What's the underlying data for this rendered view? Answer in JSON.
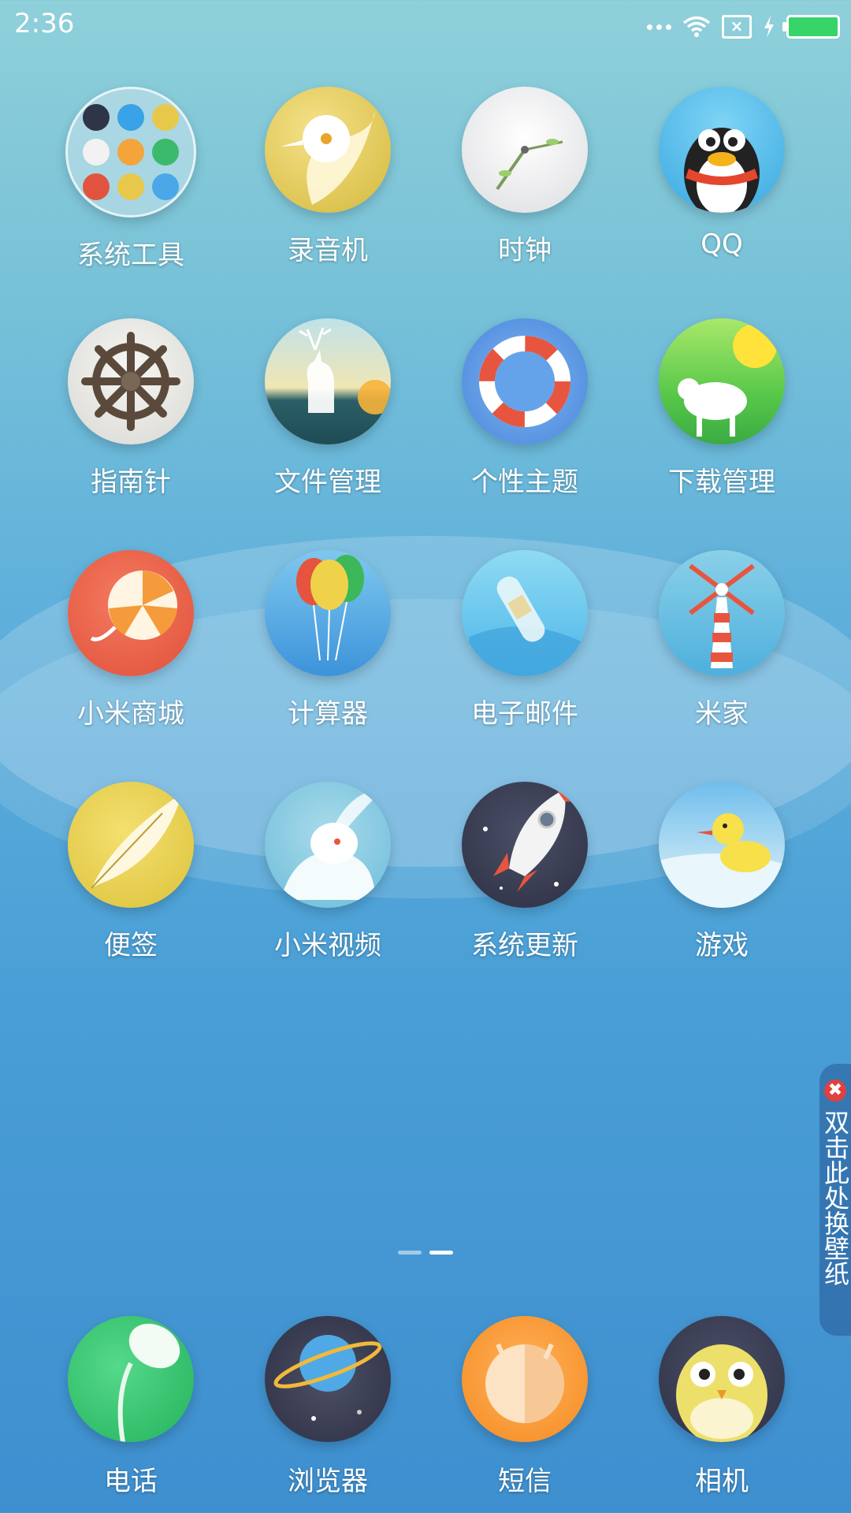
{
  "status": {
    "time": "2:36"
  },
  "rows": [
    [
      {
        "name": "系统工具"
      },
      {
        "name": "录音机"
      },
      {
        "name": "时钟"
      },
      {
        "name": "QQ"
      }
    ],
    [
      {
        "name": "指南针"
      },
      {
        "name": "文件管理"
      },
      {
        "name": "个性主题"
      },
      {
        "name": "下载管理"
      }
    ],
    [
      {
        "name": "小米商城"
      },
      {
        "name": "计算器"
      },
      {
        "name": "电子邮件"
      },
      {
        "name": "米家"
      }
    ],
    [
      {
        "name": "便签"
      },
      {
        "name": "小米视频"
      },
      {
        "name": "系统更新"
      },
      {
        "name": "游戏"
      }
    ]
  ],
  "dock": [
    {
      "name": "电话"
    },
    {
      "name": "浏览器"
    },
    {
      "name": "短信"
    },
    {
      "name": "相机"
    }
  ],
  "pages": {
    "count": 2,
    "current": 2
  },
  "wallpaper_tab": {
    "text": "双击此处换壁纸",
    "close": "✖"
  }
}
